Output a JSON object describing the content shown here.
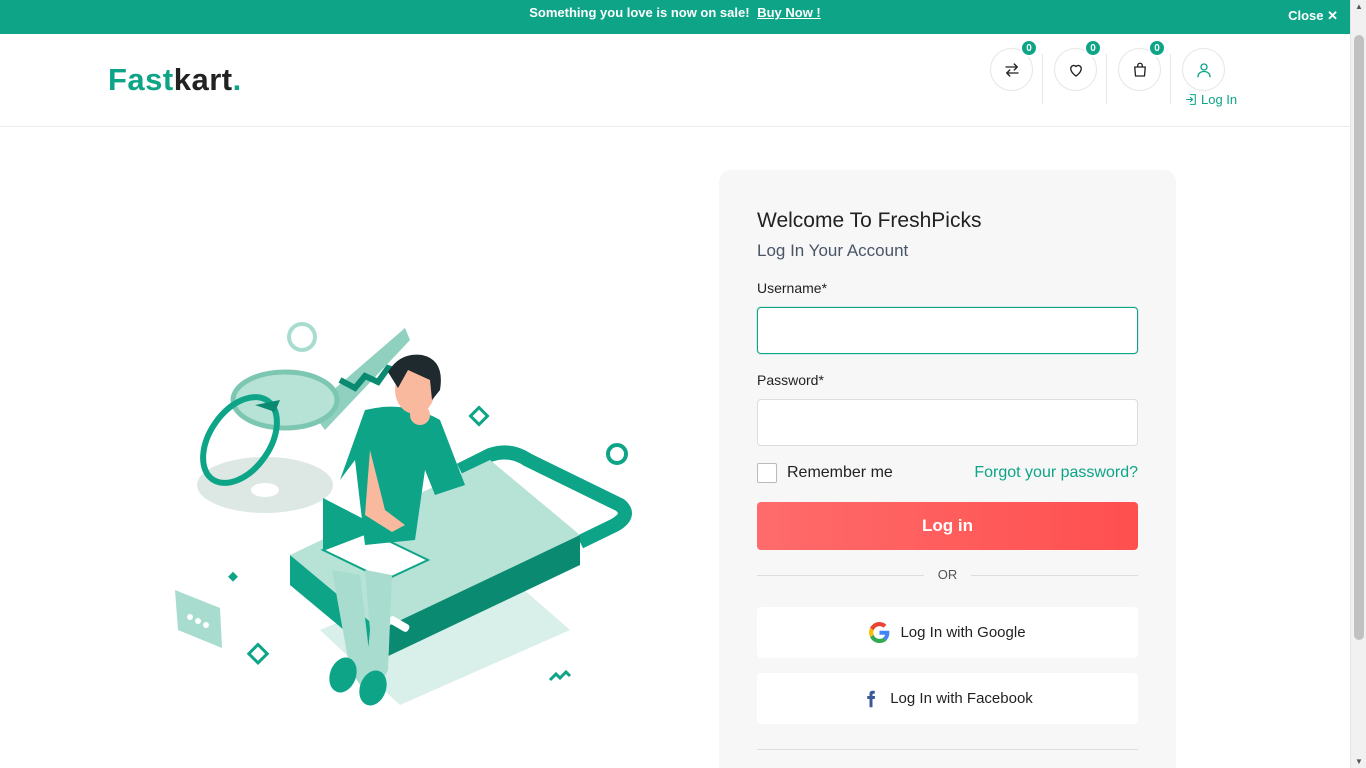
{
  "banner": {
    "text": "Something you love is now on sale!",
    "cta": "Buy Now !",
    "close_label": "Close"
  },
  "header": {
    "logo_primary": "Fast",
    "logo_secondary": "kart",
    "logo_dot": ".",
    "compare_count": "0",
    "wishlist_count": "0",
    "cart_count": "0",
    "login_label": "Log In"
  },
  "login": {
    "title": "Welcome To FreshPicks",
    "subtitle": "Log In Your Account",
    "username_label": "Username*",
    "username_value": "",
    "password_label": "Password*",
    "password_value": "",
    "remember_label": "Remember me",
    "forgot_label": "Forgot your password?",
    "submit_label": "Log in",
    "divider_label": "OR",
    "google_label": "Log In with Google",
    "facebook_label": "Log In with Facebook"
  },
  "colors": {
    "brand": "#0da487",
    "login_button": "#ff5a5a"
  },
  "icons": {
    "compare": "arrows-exchange-icon",
    "wishlist": "heart-icon",
    "cart": "shopping-bag-icon",
    "user": "user-icon",
    "login": "login-icon",
    "google": "google-icon",
    "facebook": "facebook-icon",
    "close": "close-icon"
  }
}
